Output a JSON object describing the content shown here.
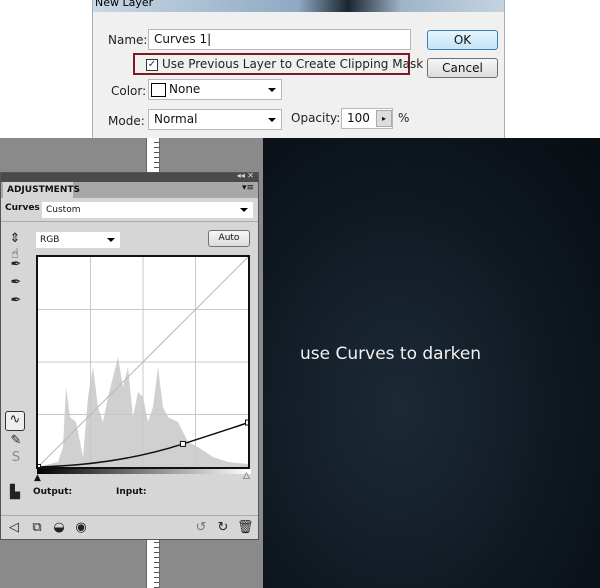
{
  "dialog": {
    "title": "New Layer",
    "name_label": "Name:",
    "name_value": "Curves 1",
    "clip_label": "Use Previous Layer to Create Clipping Mask",
    "clip_checked": true,
    "color_label": "Color:",
    "color_value": "None",
    "mode_label": "Mode:",
    "mode_value": "Normal",
    "opacity_label": "Opacity:",
    "opacity_value": "100",
    "opacity_unit": "%",
    "ok": "OK",
    "cancel": "Cancel",
    "highlight_color": "#7a1a22"
  },
  "panel": {
    "tab": "ADJUSTMENTS",
    "type_label": "Curves",
    "preset": "Custom",
    "channel": "RGB",
    "auto": "Auto",
    "output_label": "Output:",
    "input_label": "Input:"
  },
  "curve": {
    "points": [
      [
        0,
        0
      ],
      [
        176,
        28
      ],
      [
        255,
        54
      ]
    ],
    "range": [
      0,
      255
    ]
  },
  "canvas": {
    "caption": "use Curves to darken",
    "background": "#0e1820"
  }
}
